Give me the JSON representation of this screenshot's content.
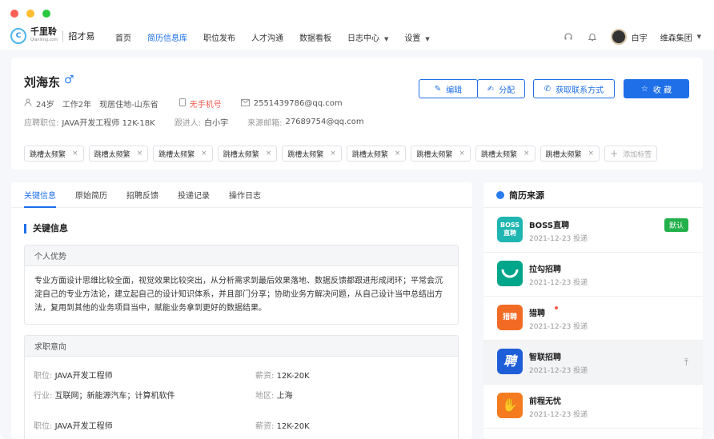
{
  "nav": {
    "logo_cn": "千里聆",
    "logo_en": "Qianlling.com",
    "app_name": "招才易",
    "menu": [
      {
        "label": "首页"
      },
      {
        "label": "简历信息库"
      },
      {
        "label": "职位发布"
      },
      {
        "label": "人才沟通"
      },
      {
        "label": "数据看板"
      },
      {
        "label": "日志中心"
      },
      {
        "label": "设置"
      }
    ],
    "user": "白宇",
    "org": "维森集团"
  },
  "profile": {
    "name": "刘海东",
    "age": "24岁",
    "work_years": "工作2年",
    "location": "现居住地-山东省",
    "phone": "无手机号",
    "email": "2551439786@qq.com",
    "applied_label": "应聘职位:",
    "applied_value": "JAVA开发工程师  12K-18K",
    "follower_label": "跟进人:",
    "follower_value": "白小宇",
    "source_email_label": "来源邮箱:",
    "source_email_value": "27689754@qq.com",
    "tags": [
      "跳槽太频繁",
      "跳槽太频繁",
      "跳槽太频繁",
      "跳槽太频繁",
      "跳槽太频繁",
      "跳槽太频繁",
      "跳槽太频繁",
      "跳槽太频繁",
      "跳槽太频繁"
    ],
    "add_tag": "添加标签",
    "buttons": {
      "edit": "编辑",
      "assign": "分配",
      "contact": "获取联系方式",
      "favorite": "收 藏"
    }
  },
  "detail": {
    "tabs": [
      "关键信息",
      "原始简历",
      "招聘反馈",
      "投递记录",
      "操作日志"
    ],
    "section_title": "关键信息",
    "advantage_title": "个人优势",
    "advantage_text": "专业方面设计思维比较全面，视觉效果比较突出，从分析需求到最后效果落地、数据反馈都跟进形成闭环；平常会沉淀自己的专业方法论，建立起自己的设计知识体系，并且部门分享；协助业务方解决问题，从自己设计当中总结出方法，复用到其他的业务项目当中，赋能业务拿到更好的数据结果。",
    "intent_title": "求职意向",
    "intents": [
      {
        "pos_label": "职位:",
        "pos": "JAVA开发工程师",
        "salary_label": "薪资:",
        "salary": "12K-20K"
      },
      {
        "ind_label": "行业:",
        "ind": "互联网；新能源汽车；计算机软件",
        "area_label": "地区:",
        "area": "上海"
      },
      {
        "pos_label": "职位:",
        "pos": "JAVA开发工程师",
        "salary_label": "薪资:",
        "salary": "12K-20K"
      }
    ]
  },
  "sources": {
    "title": "简历来源",
    "items": [
      {
        "name": "BOSS直聘",
        "date": "2021-12-23 投递",
        "logo": "BOSS\n直聘",
        "color": "#1fb5b0",
        "badge": "默认"
      },
      {
        "name": "拉勾招聘",
        "date": "2021-12-23 投递",
        "logo": "",
        "color": "#00a58a"
      },
      {
        "name": "猎聘",
        "date": "2021-12-23 投递",
        "logo": "猎聘",
        "color": "#f26b24"
      },
      {
        "name": "智联招聘",
        "date": "2021-12-23 投递",
        "logo": "聘",
        "color": "#1e5fd8"
      },
      {
        "name": "前程无忧",
        "date": "2021-12-23 投递",
        "logo": "✋",
        "color": "#f47b20"
      }
    ]
  },
  "colors": {
    "accent": "#1e6fe8",
    "danger": "#f15b4e",
    "success": "#22b04a"
  }
}
